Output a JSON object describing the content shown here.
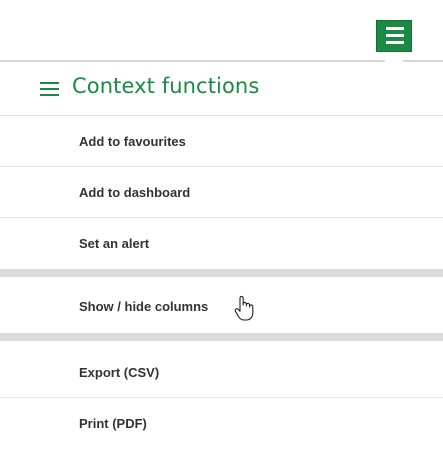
{
  "toolbar": {
    "toggle_icon": "document-menu-icon",
    "accent_color": "#1b8a45"
  },
  "panel": {
    "title": "Context functions",
    "title_icon": "hamburger-icon",
    "items": [
      {
        "label": "Add to favourites"
      },
      {
        "label": "Add to dashboard"
      },
      {
        "label": "Set an alert"
      },
      {
        "label": "Show / hide columns",
        "state": "hovered",
        "cursor": "hand-pointer-icon"
      },
      {
        "label": "Export (CSV)"
      },
      {
        "label": "Print (PDF)"
      }
    ]
  }
}
